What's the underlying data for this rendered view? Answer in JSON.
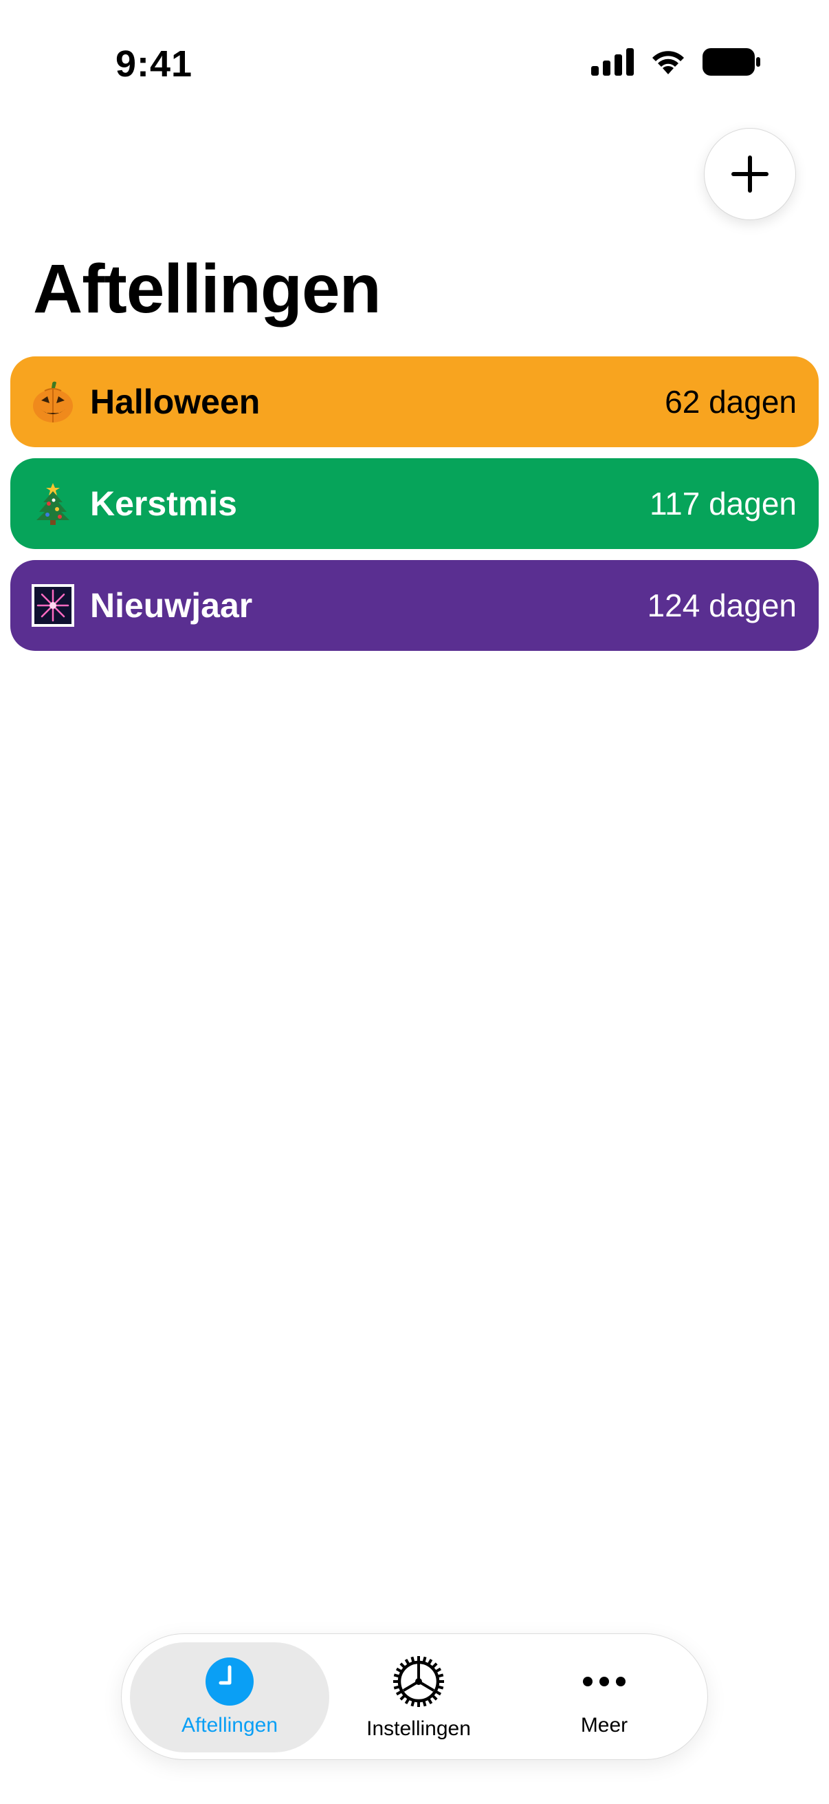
{
  "status_bar": {
    "time": "9:41"
  },
  "header": {
    "title": "Aftellingen",
    "add_icon": "plus-icon"
  },
  "countdowns": [
    {
      "name": "Halloween",
      "days": "62 dagen",
      "icon": "jack-o-lantern-icon",
      "color": "#F8A41F",
      "text_color": "#000000"
    },
    {
      "name": "Kerstmis",
      "days": "117 dagen",
      "icon": "christmas-tree-icon",
      "color": "#06A45A",
      "text_color": "#ffffff"
    },
    {
      "name": "Nieuwjaar",
      "days": "124 dagen",
      "icon": "fireworks-icon",
      "color": "#5A2F91",
      "text_color": "#ffffff"
    }
  ],
  "tab_bar": {
    "tabs": [
      {
        "label": "Aftellingen",
        "icon": "clock-icon",
        "active": true
      },
      {
        "label": "Instellingen",
        "icon": "gear-icon",
        "active": false
      },
      {
        "label": "Meer",
        "icon": "ellipsis-icon",
        "active": false
      }
    ]
  },
  "colors": {
    "accent": "#0A9FF5",
    "background": "#FFFFFF"
  }
}
